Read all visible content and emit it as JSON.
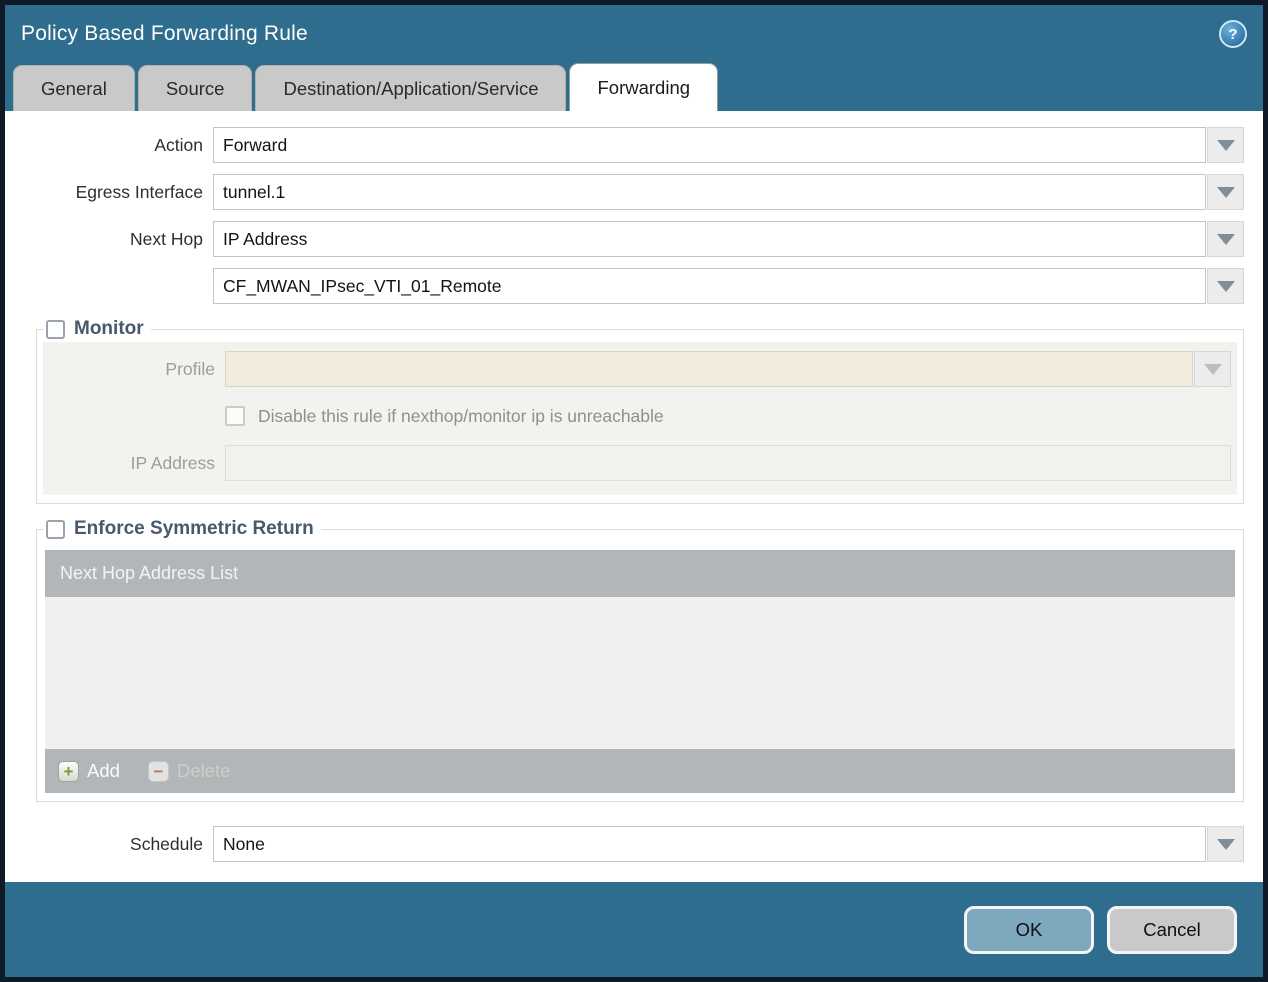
{
  "dialog": {
    "title": "Policy Based Forwarding Rule"
  },
  "icons": {
    "help_glyph": "?",
    "add_glyph": "+",
    "delete_glyph": "−"
  },
  "tabs": [
    {
      "label": "General",
      "active": false
    },
    {
      "label": "Source",
      "active": false
    },
    {
      "label": "Destination/Application/Service",
      "active": false
    },
    {
      "label": "Forwarding",
      "active": true
    }
  ],
  "form": {
    "action": {
      "label": "Action",
      "value": "Forward"
    },
    "egress_interface": {
      "label": "Egress Interface",
      "value": "tunnel.1"
    },
    "next_hop": {
      "label": "Next Hop",
      "value": "IP Address"
    },
    "next_hop_address": {
      "value": "CF_MWAN_IPsec_VTI_01_Remote"
    },
    "schedule": {
      "label": "Schedule",
      "value": "None"
    }
  },
  "monitor": {
    "title": "Monitor",
    "checked": false,
    "profile": {
      "label": "Profile",
      "value": "",
      "placeholder": ""
    },
    "disable_rule_checkbox": {
      "label": "Disable this rule if nexthop/monitor ip is unreachable",
      "checked": false
    },
    "ip_address": {
      "label": "IP Address",
      "value": "",
      "placeholder": ""
    }
  },
  "enforce_symmetric_return": {
    "title": "Enforce Symmetric Return",
    "checked": false,
    "next_hop_address_list": {
      "header": "Next Hop Address List",
      "rows": []
    },
    "add_button": "Add",
    "delete_button": "Delete",
    "delete_enabled": false
  },
  "footer": {
    "ok": "OK",
    "cancel": "Cancel"
  },
  "colors": {
    "titlebar": "#2e6d8d",
    "active_tab": "#ffffff",
    "inactive_tab": "#c9c9c9",
    "section_title": "#48596b",
    "table_chrome": "#b2b6b8",
    "disabled_field_beige": "#f0ebdc",
    "ok_button": "#7da8bd",
    "cancel_button": "#c9c9cb"
  }
}
